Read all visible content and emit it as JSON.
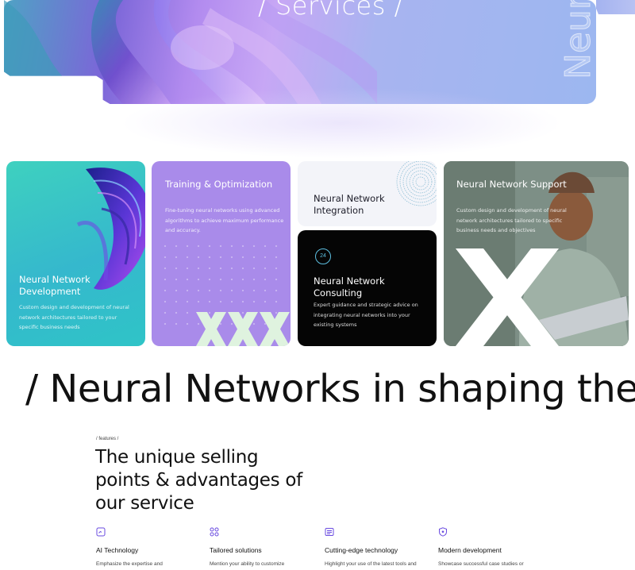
{
  "hero": {
    "title": "/ Services /",
    "side_text": "Neur"
  },
  "cards": [
    {
      "title": "Neural Network Development",
      "desc": "Custom design and development of neural network architectures tailored to your specific business needs"
    },
    {
      "title": "Training & Optimization",
      "desc": "Fine-tuning neural networks using advanced algorithms to achieve maximum performance and accuracy."
    },
    {
      "title": "Neural Network Integration",
      "desc": ""
    },
    {
      "title": "Neural Network Consulting",
      "desc": "Expert guidance and strategic advice on integrating neural networks into your existing systems",
      "badge": "24"
    },
    {
      "title": "Neural Network Support",
      "desc": "Custom design and development of neural network architectures tailored to specific business needs and objectives"
    }
  ],
  "headline": "/ Neural Networks in shaping the",
  "features_section": {
    "eyebrow": "/ features /",
    "title": "The unique selling points & advantages of our service",
    "items": [
      {
        "icon": "chat-square-icon",
        "name": "AI Technology",
        "desc": "Emphasize the expertise and"
      },
      {
        "icon": "grid-circles-icon",
        "name": "Tailored solutions",
        "desc": "Mention your ability to customize"
      },
      {
        "icon": "document-list-icon",
        "name": "Cutting-edge technology",
        "desc": "Highlight your use of the latest tools and"
      },
      {
        "icon": "shield-check-icon",
        "name": "Modern development",
        "desc": "Showcase successful case studies or"
      }
    ]
  },
  "colors": {
    "accent_teal": "#3ed1bf",
    "accent_purple": "#a98bea",
    "dark_card": "#050505",
    "badge_blue": "#5dbfe0"
  }
}
